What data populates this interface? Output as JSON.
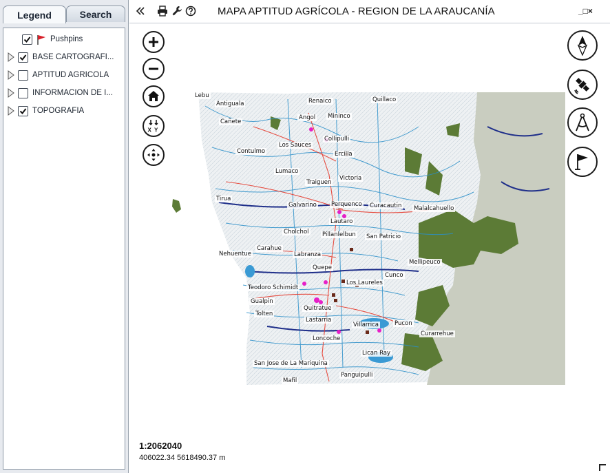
{
  "panel": {
    "tabs": [
      {
        "label": "Legend"
      },
      {
        "label": "Search"
      }
    ],
    "layers": [
      {
        "label": "Pushpins",
        "checked": true
      },
      {
        "label": "BASE CARTOGRÁFI...",
        "checked": true
      },
      {
        "label": "APTITUD AGRÍCOLA",
        "checked": false
      },
      {
        "label": "INFORMACIÓN DE I...",
        "checked": false
      },
      {
        "label": "TOPOGRAFÍA",
        "checked": true
      }
    ]
  },
  "header": {
    "title": "MAPA APTITUD AGRÍCOLA - REGION DE LA ARAUCANÍA",
    "window_controls": "_□×"
  },
  "map": {
    "places": [
      {
        "name": "Lebu"
      },
      {
        "name": "Antiguala"
      },
      {
        "name": "Renaico"
      },
      {
        "name": "Quillaco"
      },
      {
        "name": "Angol"
      },
      {
        "name": "Mininco"
      },
      {
        "name": "Cañete"
      },
      {
        "name": "Collipulli"
      },
      {
        "name": "Los Sauces"
      },
      {
        "name": "Contulmo"
      },
      {
        "name": "Ercilla"
      },
      {
        "name": "Lumaco"
      },
      {
        "name": "Victoria"
      },
      {
        "name": "Traiguen"
      },
      {
        "name": "Tirua"
      },
      {
        "name": "Galvarino"
      },
      {
        "name": "Perquenco"
      },
      {
        "name": "Curacautin"
      },
      {
        "name": "Malalcahuello"
      },
      {
        "name": "Lautaro"
      },
      {
        "name": "Cholchol"
      },
      {
        "name": "Pillanlelbun"
      },
      {
        "name": "San Patricio"
      },
      {
        "name": "Carahue"
      },
      {
        "name": "Nehuentue"
      },
      {
        "name": "Labranza"
      },
      {
        "name": "Mellipeuco"
      },
      {
        "name": "Quepe"
      },
      {
        "name": "Cunco"
      },
      {
        "name": "Teodoro Schimidt"
      },
      {
        "name": "Los Laureles"
      },
      {
        "name": "Gualpin"
      },
      {
        "name": "Quitratue"
      },
      {
        "name": "Tolten"
      },
      {
        "name": "Lastarria"
      },
      {
        "name": "Villarrica"
      },
      {
        "name": "Pucon"
      },
      {
        "name": "Curarrehue"
      },
      {
        "name": "Loncoche"
      },
      {
        "name": "Lican Ray"
      },
      {
        "name": "San Jose de La Mariquina"
      },
      {
        "name": "Panguipulli"
      },
      {
        "name": "Mafil"
      }
    ],
    "scale": "1:2062040",
    "coordinates": "406022.34   5618490.37 m"
  },
  "colors": {
    "panel_bg": "#e7eaef",
    "map_base": "#e9eef2",
    "andes": "#c8cdc0",
    "forest": "#5c7b36",
    "water": "#2a8fc9",
    "roads": "#e63b2e",
    "pins": "#e61fc7"
  }
}
